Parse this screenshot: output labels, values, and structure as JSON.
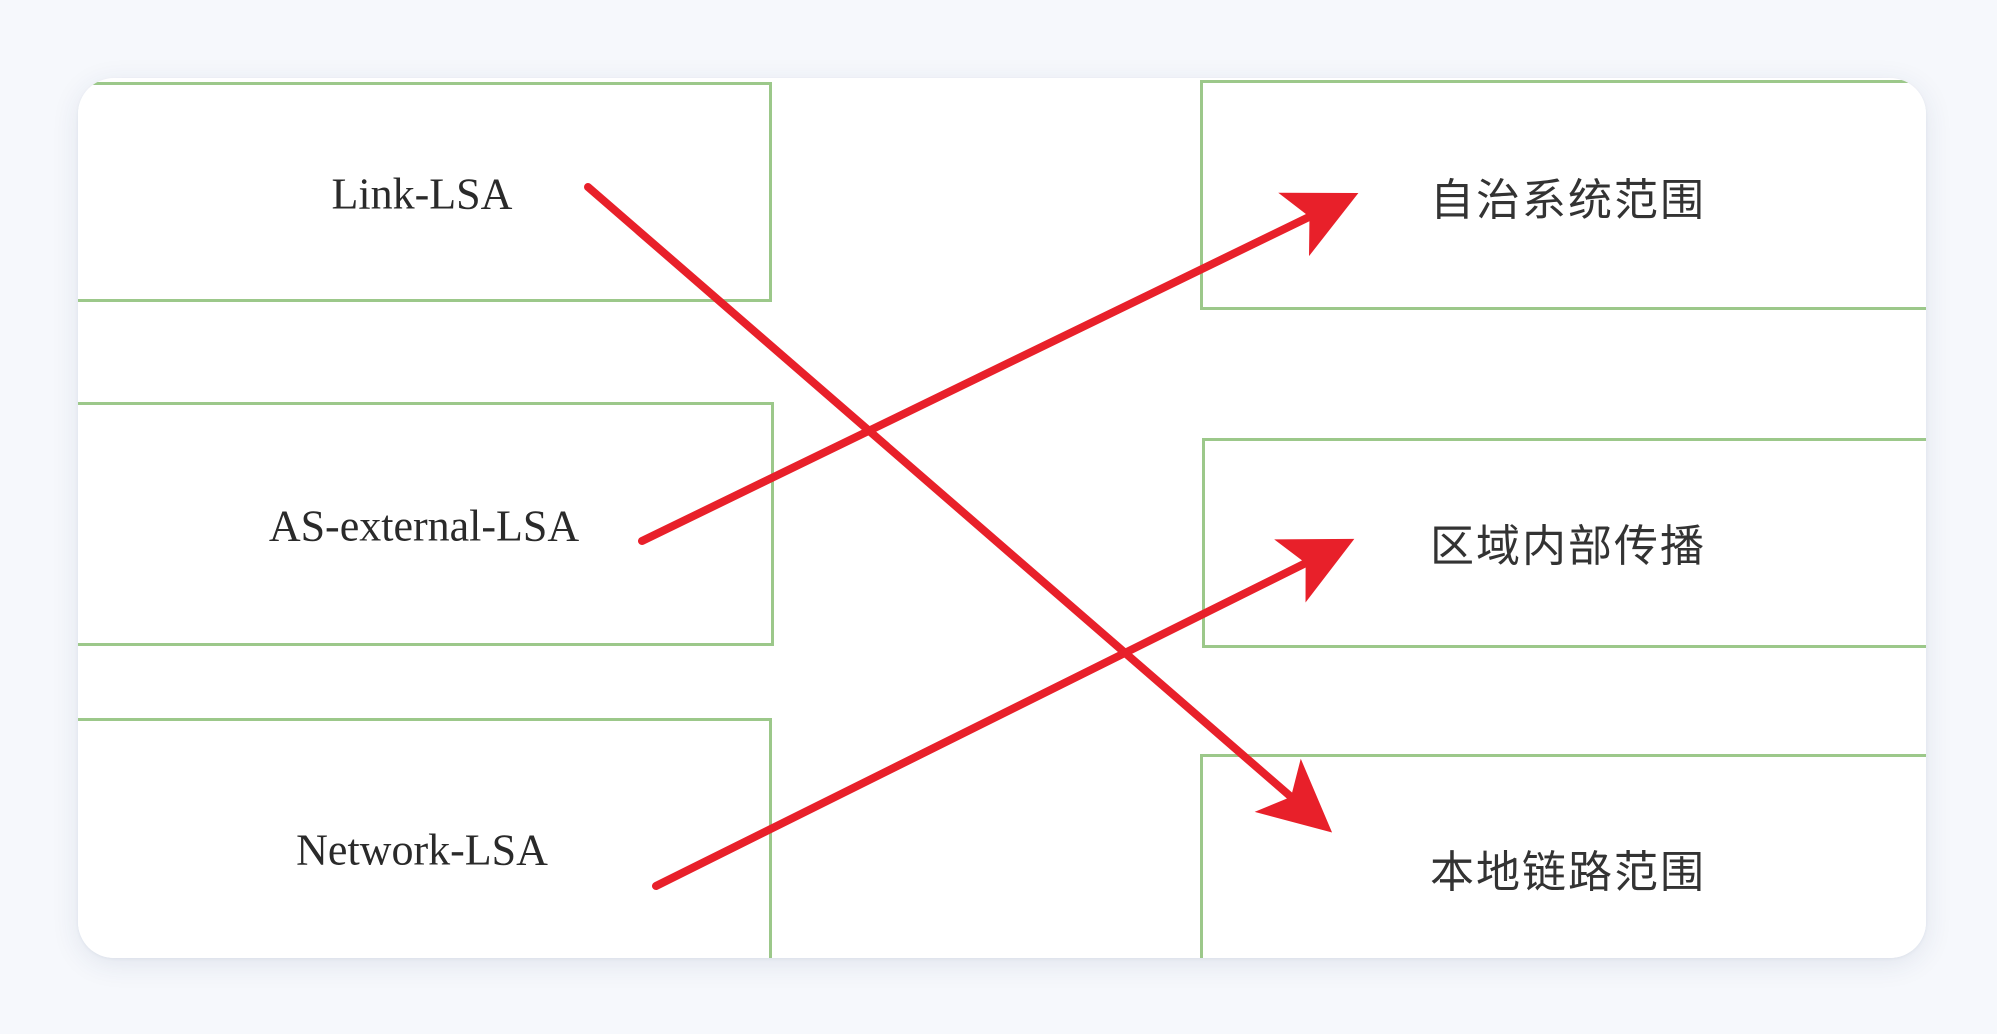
{
  "diagram": {
    "left_items": [
      {
        "id": "link-lsa",
        "label": "Link-LSA"
      },
      {
        "id": "as-external-lsa",
        "label": "AS-external-LSA"
      },
      {
        "id": "network-lsa",
        "label": "Network-LSA"
      }
    ],
    "right_items": [
      {
        "id": "as-scope",
        "label": "自治系统范围"
      },
      {
        "id": "area-scope",
        "label": "区域内部传播"
      },
      {
        "id": "link-local-scope",
        "label": "本地链路范围"
      }
    ],
    "connections": [
      {
        "from": "link-lsa",
        "to": "link-local-scope"
      },
      {
        "from": "as-external-lsa",
        "to": "as-scope"
      },
      {
        "from": "network-lsa",
        "to": "area-scope"
      }
    ],
    "colors": {
      "arrow": "#e8202a",
      "box_border": "#9cc88a"
    }
  }
}
